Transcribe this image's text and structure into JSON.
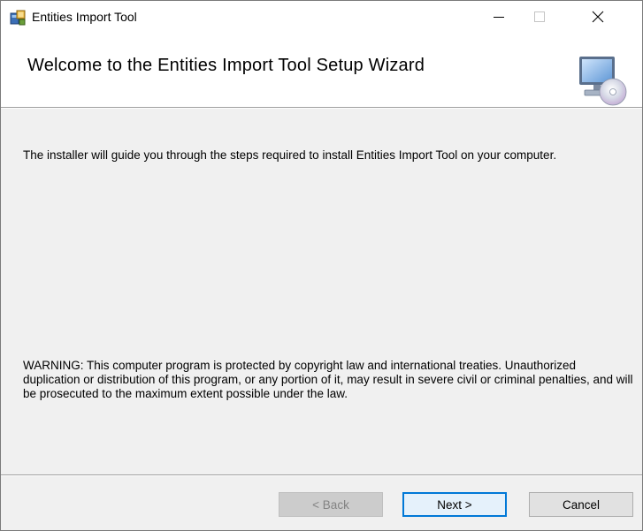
{
  "window": {
    "title": "Entities Import Tool",
    "controls": {
      "minimize_icon": "minimize-icon",
      "maximize_icon": "maximize-icon",
      "close_icon": "close-icon"
    }
  },
  "banner": {
    "title": "Welcome to the Entities Import Tool Setup Wizard",
    "art_icon": "computer-cd-icon"
  },
  "body": {
    "intro": "The installer will guide you through the steps required to install Entities Import Tool on your computer.",
    "warning": "WARNING: This computer program is protected by copyright law and international treaties. Unauthorized duplication or distribution of this program, or any portion of it, may result in severe civil or criminal penalties, and will be prosecuted to the maximum extent possible under the law."
  },
  "buttons": {
    "back": "< Back",
    "next": "Next >",
    "cancel": "Cancel"
  },
  "colors": {
    "window_bg": "#f0f0f0",
    "accent": "#0078d7",
    "disabled_text": "#838383"
  }
}
